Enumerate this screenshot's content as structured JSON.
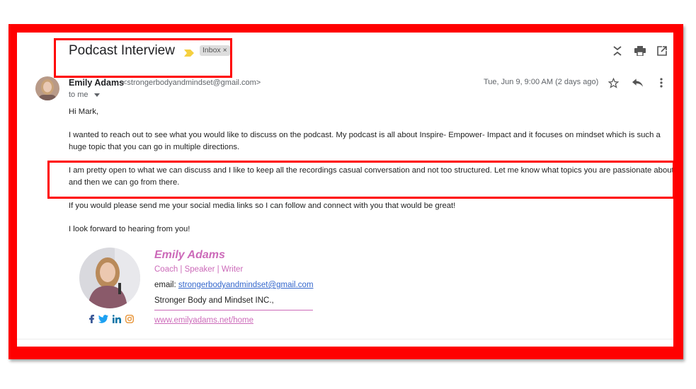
{
  "email": {
    "subject": "Podcast Interview",
    "label_chip": {
      "text": "Inbox",
      "close": "×"
    },
    "toolbar": {
      "icons": [
        "collapse-all-icon",
        "print-icon",
        "open-in-new-window-icon"
      ]
    },
    "sender": {
      "name": "Emily Adams",
      "email": "<strongerbodyandmindset@gmail.com>",
      "to": "to me"
    },
    "date": "Tue, Jun 9, 9:00 AM (2 days ago)",
    "message_actions": {
      "icons": [
        "star-icon",
        "reply-icon",
        "more-vert-icon"
      ]
    },
    "body": {
      "greeting": "Hi Mark,",
      "paragraph1": "I wanted to reach out to see what you would like to discuss on the podcast. My podcast is all about Inspire- Empower- Impact and it focuses on mindset which is such a huge topic that you can go in multiple directions.",
      "paragraph2": "I am pretty open to what we can discuss and I like to keep all the recordings casual conversation and not too structured. Let me know what topics you are passionate about and then we can go from there.",
      "paragraph3": "If you would please send me your social media links so I can follow and connect with you that would be great!",
      "paragraph4": "I look forward to hearing from you!"
    },
    "signature": {
      "name": "Emily Adams",
      "roles": "Coach | Speaker | Writer",
      "email_label": "email: ",
      "email": "strongerbodyandmindset@gmail.com",
      "company": "Stronger Body and Mindset INC.,",
      "website": "www.emilyadams.net/home",
      "social_icons": [
        "facebook-icon",
        "twitter-icon",
        "linkedin-icon",
        "instagram-icon"
      ]
    }
  },
  "colors": {
    "annotation_red": "#ff0000",
    "signature_pink": "#cc6ab9",
    "link_blue": "#3366cc",
    "importance_yellow": "#f5d040"
  }
}
